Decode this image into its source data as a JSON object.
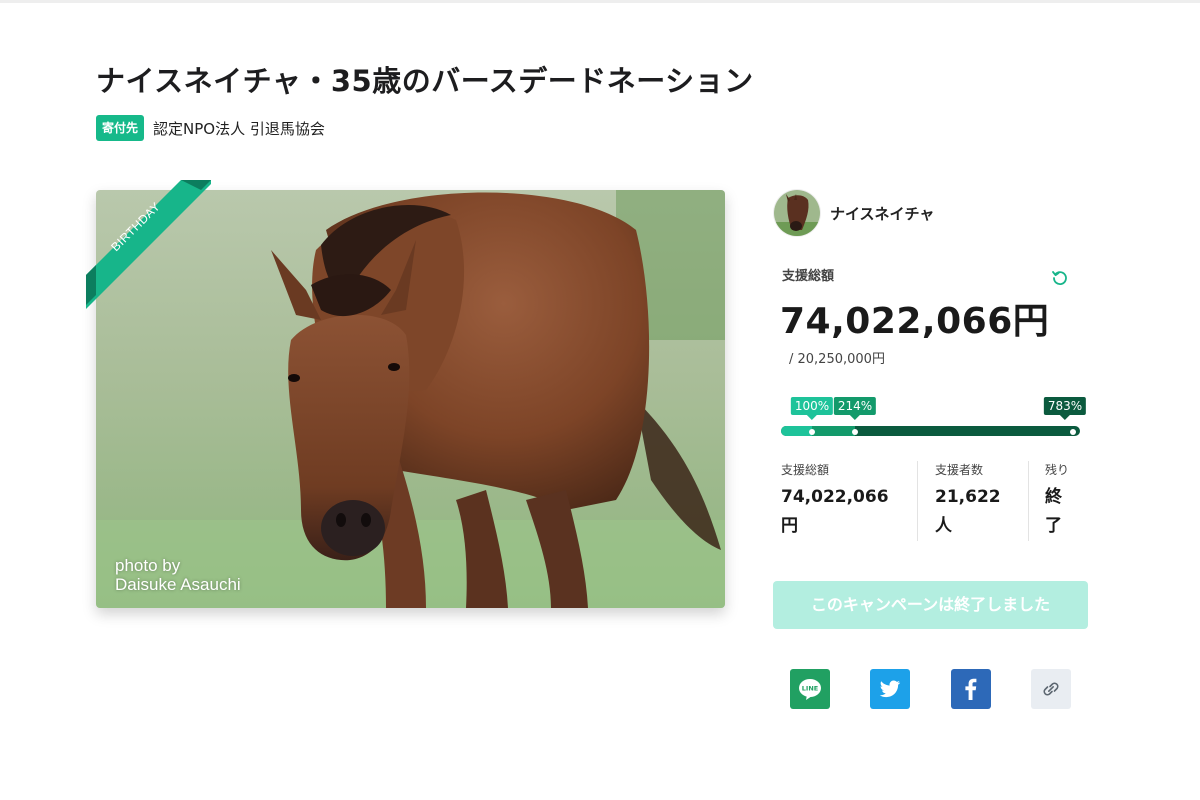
{
  "campaign": {
    "title": "ナイスネイチャ・35歳のバースデードネーション",
    "donation_tag": "寄付先",
    "donation_org": "認定NPO法人 引退馬協会",
    "ribbon_text": "BIRTHDAY",
    "photo_credit_line1": "photo by",
    "photo_credit_line2": "Daisuke Asauchi"
  },
  "owner": {
    "name": "ナイスネイチャ"
  },
  "summary": {
    "total_label": "支援総額",
    "total_amount": "74,022,066円",
    "goal_text": "/ 20,250,000円"
  },
  "progress": {
    "markers": [
      {
        "label": "100%",
        "fraction": 0.128,
        "color": "#1ec39a"
      },
      {
        "label": "214%",
        "fraction": 0.273,
        "color": "#139a6b"
      },
      {
        "label": "783%",
        "fraction": 1.0,
        "color": "#0b5a3e"
      }
    ]
  },
  "stats": [
    {
      "label": "支援総額",
      "value": "74,022,066円"
    },
    {
      "label": "支援者数",
      "value": "21,622人"
    },
    {
      "label": "残り",
      "value": "終了"
    }
  ],
  "status_button": {
    "label": "このキャンペーンは終了しました"
  },
  "share": {
    "line_text": "LINE",
    "line_color": "#21a062",
    "twitter_color": "#1da1e9",
    "facebook_color": "#2d69b8",
    "link_bg": "#e9edf2"
  },
  "icons": [
    "refresh-icon",
    "line-icon",
    "twitter-icon",
    "facebook-icon",
    "link-icon"
  ]
}
